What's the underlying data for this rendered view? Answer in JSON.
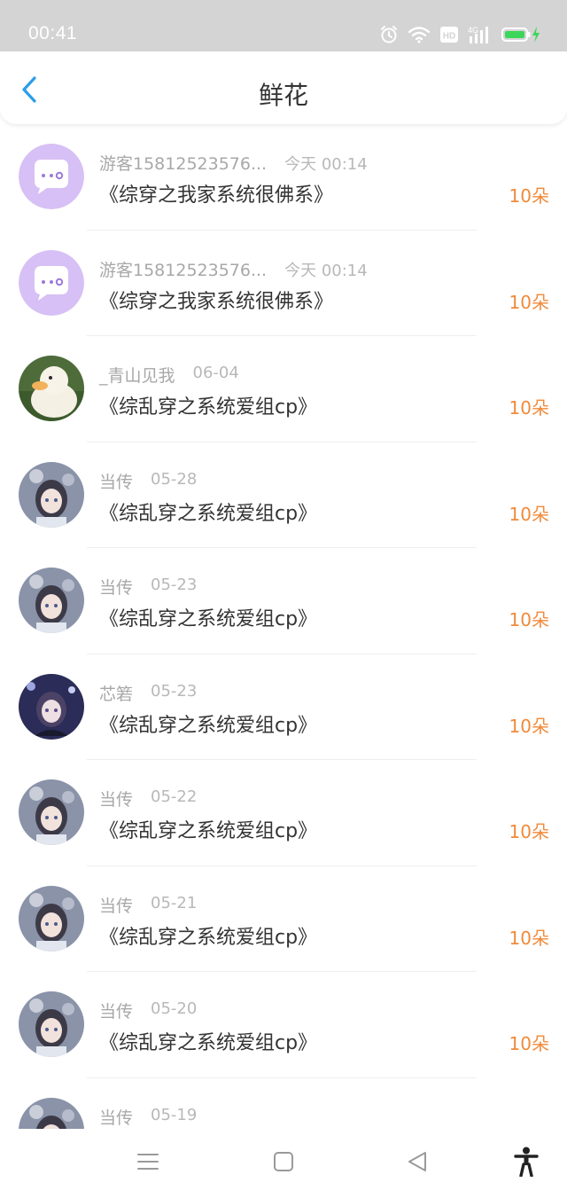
{
  "status": {
    "time": "00:41",
    "hd": "HD",
    "net": "4G"
  },
  "header": {
    "title": "鲜花"
  },
  "items": [
    {
      "name": "游客15812523576...",
      "date": "今天 00:14",
      "book": "《综穿之我家系统很佛系》",
      "count": "10朵"
    },
    {
      "name": "游客15812523576...",
      "date": "今天 00:14",
      "book": "《综穿之我家系统很佛系》",
      "count": "10朵"
    },
    {
      "name": "_青山见我",
      "date": "06-04",
      "book": "《综乱穿之系统爱组cp》",
      "count": "10朵"
    },
    {
      "name": "当传",
      "date": "05-28",
      "book": "《综乱穿之系统爱组cp》",
      "count": "10朵"
    },
    {
      "name": "当传",
      "date": "05-23",
      "book": "《综乱穿之系统爱组cp》",
      "count": "10朵"
    },
    {
      "name": "芯箬",
      "date": "05-23",
      "book": "《综乱穿之系统爱组cp》",
      "count": "10朵"
    },
    {
      "name": "当传",
      "date": "05-22",
      "book": "《综乱穿之系统爱组cp》",
      "count": "10朵"
    },
    {
      "name": "当传",
      "date": "05-21",
      "book": "《综乱穿之系统爱组cp》",
      "count": "10朵"
    },
    {
      "name": "当传",
      "date": "05-20",
      "book": "《综乱穿之系统爱组cp》",
      "count": "10朵"
    },
    {
      "name": "当传",
      "date": "05-19",
      "book": "",
      "count": ""
    }
  ],
  "colors": {
    "accent": "#2a9ee8",
    "count": "#f08a3a",
    "statusbar": "#d4d4d4"
  }
}
